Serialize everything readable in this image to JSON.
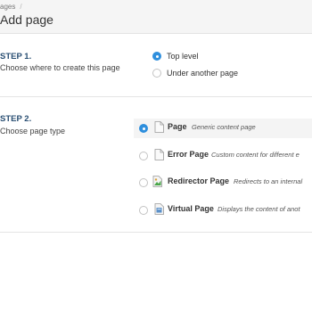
{
  "breadcrumb": {
    "parent": "ages",
    "separator": "/"
  },
  "title": "Add page",
  "step1": {
    "title": "STEP 1.",
    "description": "Choose where to create this page",
    "options": [
      {
        "label": "Top level",
        "checked": true
      },
      {
        "label": "Under another page",
        "checked": false
      }
    ]
  },
  "step2": {
    "title": "STEP 2.",
    "description": "Choose page type",
    "types": [
      {
        "name": "Page",
        "description": "Generic content page",
        "icon": "page-icon",
        "checked": true
      },
      {
        "name": "Error Page",
        "description": "Custom content for different e",
        "icon": "error-page-icon",
        "checked": false
      },
      {
        "name": "Redirector Page",
        "description": "Redirects to an internal",
        "icon": "redirector-page-icon",
        "checked": false
      },
      {
        "name": "Virtual Page",
        "description": "Displays the content of anot",
        "icon": "virtual-page-icon",
        "checked": false
      }
    ]
  },
  "colors": {
    "accent": "#2f8fdd",
    "step_title": "#2a4f73"
  }
}
